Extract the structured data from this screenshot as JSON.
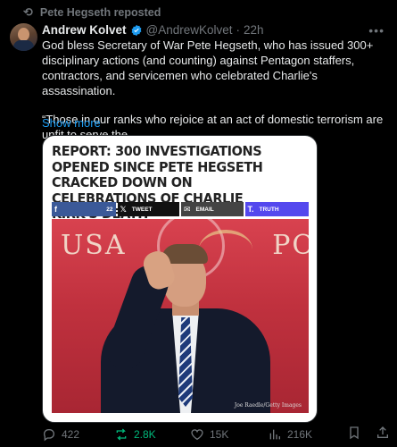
{
  "repost_banner": {
    "text": "Pete Hegseth reposted",
    "icon": "repost-icon"
  },
  "author": {
    "name": "Andrew Kolvet",
    "handle": "@AndrewKolvet",
    "separator": "·",
    "time": "22h",
    "verified_color": "#1d9bf0"
  },
  "tweet": {
    "paragraph1": "God bless Secretary of War Pete Hegseth, who has issued 300+ disciplinary actions (and counting) against Pentagon staffers, contractors, and servicemen who celebrated Charlie's assassination.",
    "paragraph2": "“Those in our ranks who rejoice at an act of domestic terrorism are unfit to serve the",
    "show_more": "Show more"
  },
  "card": {
    "headline": "REPORT: 300 INVESTIGATIONS OPENED SINCE PETE HEGSETH CRACKED DOWN ON CELEBRATIONS OF CHARLIE KIRK'S DEATH",
    "share": {
      "facebook_icon": "f",
      "facebook_count": "22",
      "x_label": "TWEET",
      "email_label": "EMAIL",
      "truth_label": "TRUTH"
    },
    "photo_bg_text_left": "USA",
    "photo_bg_text_right": "PO",
    "photo_credit": "Joe Raedle/Getty Images"
  },
  "actions": {
    "replies": "422",
    "reposts": "2.8K",
    "likes": "15K",
    "views": "216K",
    "repost_color": "#00ba7c",
    "muted_color": "#71767b"
  },
  "link_color": "#1d9bf0"
}
